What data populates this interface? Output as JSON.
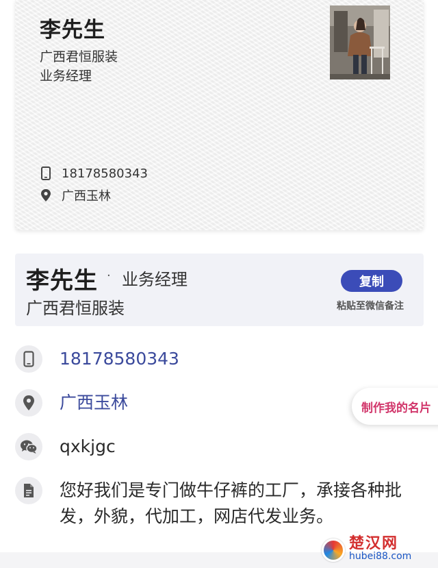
{
  "card": {
    "name": "李先生",
    "company": "广西君恒服装",
    "title": "业务经理",
    "phone": "18178580343",
    "location": "广西玉林"
  },
  "panel": {
    "name": "李先生",
    "dot": "·",
    "title": "业务经理",
    "company": "广西君恒服装",
    "copy_label": "复制",
    "copy_hint": "粘贴至微信备注"
  },
  "details": {
    "phone": "18178580343",
    "location": "广西玉林",
    "wechat": "qxkjgc",
    "intro": "您好我们是专门做牛仔裤的工厂，承接各种批发，外貌，代加工，网店代发业务。"
  },
  "float_button": {
    "label": "制作我的名片"
  },
  "watermark": {
    "main": "楚汉网",
    "sub": "hubei88.com"
  },
  "colors": {
    "accent": "#3b4cb8",
    "link": "#3b4a9c",
    "pink": "#d1356a"
  }
}
